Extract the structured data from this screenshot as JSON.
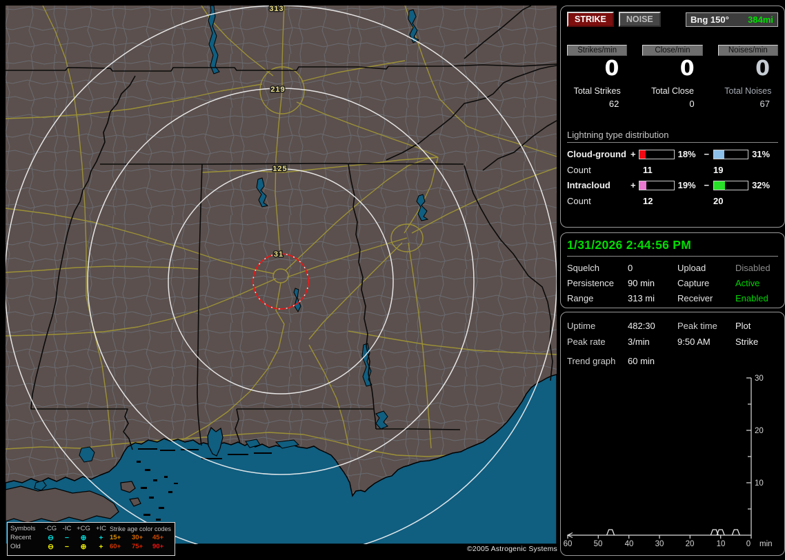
{
  "header": {
    "strike": "STRIKE",
    "noise": "NOISE",
    "bearing_label": "Bng 150°",
    "bearing_value": "384mi"
  },
  "counters": [
    {
      "badge": "Strikes/min",
      "rate": "0",
      "total_label": "Total Strikes",
      "total": "62"
    },
    {
      "badge": "Close/min",
      "rate": "0",
      "total_label": "Total Close",
      "total": "0"
    },
    {
      "badge": "Noises/min",
      "rate": "0",
      "total_label": "Total Noises",
      "total": "67"
    }
  ],
  "distribution": {
    "title": "Lightning type distribution",
    "count_label": "Count",
    "plus_sign": "+",
    "minus_sign": "−",
    "rows": [
      {
        "label": "Cloud-ground",
        "plus_pct": "18%",
        "plus_fill": 18,
        "plus_color": "#f00814",
        "plus_count": "11",
        "minus_pct": "31%",
        "minus_fill": 31,
        "minus_color": "#8cc0ea",
        "minus_count": "19"
      },
      {
        "label": "Intracloud",
        "plus_pct": "19%",
        "plus_fill": 19,
        "plus_color": "#e878d0",
        "plus_count": "12",
        "minus_pct": "32%",
        "minus_fill": 32,
        "minus_color": "#28e028",
        "minus_count": "20"
      }
    ]
  },
  "status": {
    "datetime": "1/31/2026 2:44:56 PM",
    "rows": [
      {
        "l1": "Squelch",
        "v1": "0",
        "l2": "Upload",
        "v2": "Disabled",
        "v2_state": "disabled"
      },
      {
        "l1": "Persistence",
        "v1": "90 min",
        "l2": "Capture",
        "v2": "Active",
        "v2_state": "active"
      },
      {
        "l1": "Range",
        "v1": "313 mi",
        "l2": "Receiver",
        "v2": "Enabled",
        "v2_state": "active"
      }
    ]
  },
  "session": {
    "rows": [
      {
        "l1": "Uptime",
        "v1": "482:30",
        "l2": "Peak time",
        "v2": "Plot"
      },
      {
        "l1": "Peak rate",
        "v1": "3/min",
        "l2": "9:50 AM",
        "v2": "Strike"
      }
    ],
    "trend_label": "Trend graph",
    "trend_value": "60 min"
  },
  "trend_graph": {
    "type": "line",
    "title": "Strike rate trend, last 60 minutes",
    "x_ticks": [
      "60",
      "50",
      "40",
      "30",
      "20",
      "10",
      "0"
    ],
    "x_unit": "min",
    "y_ticks": [
      "30",
      "20",
      "10"
    ],
    "y_max": 30,
    "peaks_minutes_ago": [
      46,
      12,
      10,
      5
    ],
    "peak_value": 1
  },
  "map": {
    "ring_labels": [
      "31",
      "125",
      "219",
      "313"
    ],
    "copyright": "©2005 Astrogenic Systems",
    "colors": {
      "land": "#5b504d",
      "water": "#105e80",
      "road": "#9c9136",
      "county": "#6d727c",
      "ring": "#f2f2f2",
      "ring_label": "#ecdf86",
      "alarm_circle": "#e41414"
    }
  },
  "legend": {
    "symbols_header": "Symbols",
    "col_headers": [
      "-CG",
      "-IC",
      "+CG",
      "+IC"
    ],
    "age_header": "Strike age color codes",
    "symbols": [
      "⊖",
      "−",
      "⊕",
      "+"
    ],
    "rows": [
      {
        "label": "Recent",
        "color": "#00d8d8",
        "ages": [
          "15+",
          "30+",
          "45+"
        ]
      },
      {
        "label": "Old",
        "color": "#e8e800",
        "ages": [
          "60+",
          "75+",
          "90+"
        ]
      }
    ],
    "age_colors": [
      "#e09000",
      "#d86800",
      "#d04800",
      "#d03800",
      "#e02400",
      "#f41010"
    ]
  }
}
